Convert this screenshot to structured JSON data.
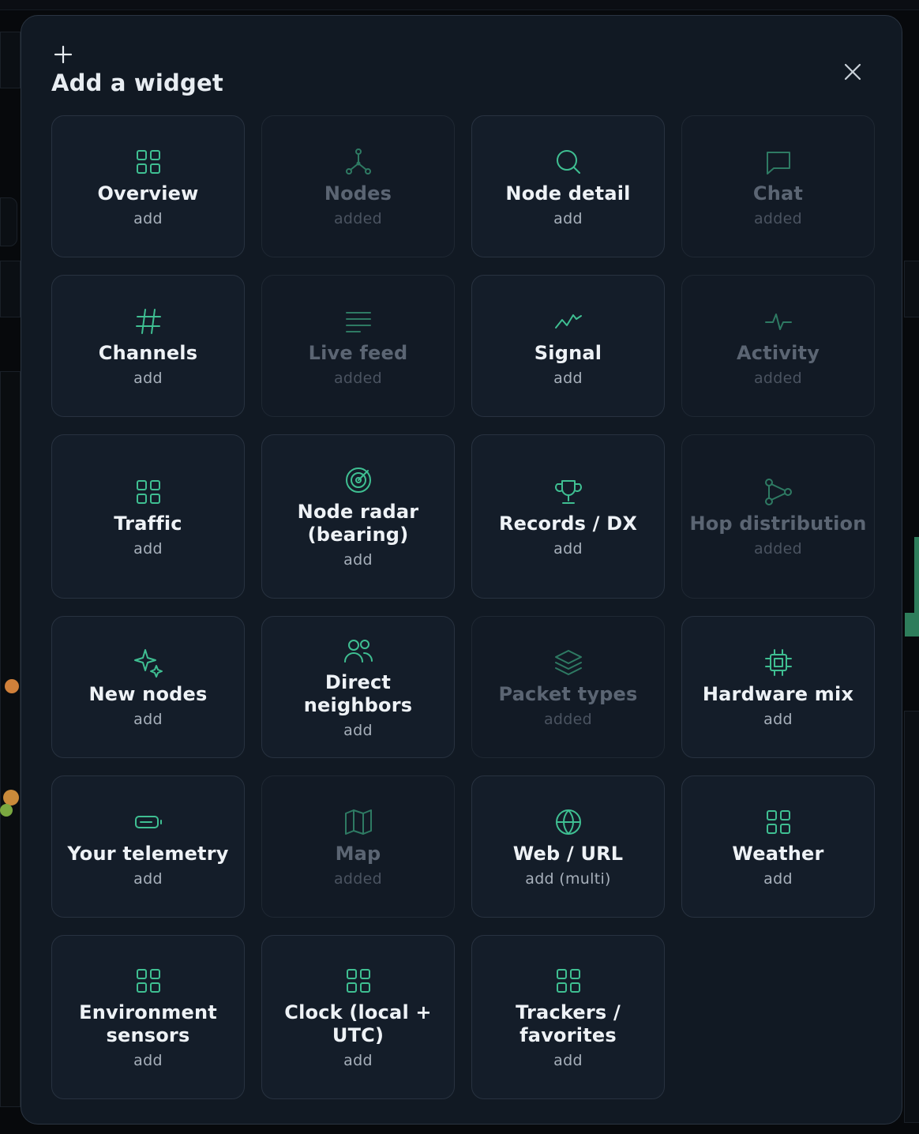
{
  "modal": {
    "title": "Add a widget"
  },
  "colors": {
    "accent": "#3fbf92",
    "accent_muted": "#2e7a63",
    "card_bg": "#141d29",
    "modal_bg": "#111923"
  },
  "widgets": [
    {
      "label": "Overview",
      "status": "add",
      "icon": "grid-icon",
      "added": false
    },
    {
      "label": "Nodes",
      "status": "added",
      "icon": "network-icon",
      "added": true
    },
    {
      "label": "Node detail",
      "status": "add",
      "icon": "search-icon",
      "added": false
    },
    {
      "label": "Chat",
      "status": "added",
      "icon": "chat-icon",
      "added": true
    },
    {
      "label": "Channels",
      "status": "add",
      "icon": "hash-icon",
      "added": false
    },
    {
      "label": "Live feed",
      "status": "added",
      "icon": "lines-icon",
      "added": true
    },
    {
      "label": "Signal",
      "status": "add",
      "icon": "trend-icon",
      "added": false
    },
    {
      "label": "Activity",
      "status": "added",
      "icon": "pulse-icon",
      "added": true
    },
    {
      "label": "Traffic",
      "status": "add",
      "icon": "grid-icon",
      "added": false
    },
    {
      "label": "Node radar (bearing)",
      "status": "add",
      "icon": "target-icon",
      "added": false
    },
    {
      "label": "Records / DX",
      "status": "add",
      "icon": "trophy-icon",
      "added": false
    },
    {
      "label": "Hop distribution",
      "status": "added",
      "icon": "share-icon",
      "added": true
    },
    {
      "label": "New nodes",
      "status": "add",
      "icon": "sparkles-icon",
      "added": false
    },
    {
      "label": "Direct neighbors",
      "status": "add",
      "icon": "users-icon",
      "added": false
    },
    {
      "label": "Packet types",
      "status": "added",
      "icon": "layers-icon",
      "added": true
    },
    {
      "label": "Hardware mix",
      "status": "add",
      "icon": "chip-icon",
      "added": false
    },
    {
      "label": "Your telemetry",
      "status": "add",
      "icon": "battery-icon",
      "added": false
    },
    {
      "label": "Map",
      "status": "added",
      "icon": "map-icon",
      "added": true
    },
    {
      "label": "Web / URL",
      "status": "add (multi)",
      "icon": "globe-icon",
      "added": false
    },
    {
      "label": "Weather",
      "status": "add",
      "icon": "grid-icon",
      "added": false
    },
    {
      "label": "Environment sensors",
      "status": "add",
      "icon": "grid-icon",
      "added": false
    },
    {
      "label": "Clock (local + UTC)",
      "status": "add",
      "icon": "grid-icon",
      "added": false
    },
    {
      "label": "Trackers / favorites",
      "status": "add",
      "icon": "grid-icon",
      "added": false
    }
  ]
}
